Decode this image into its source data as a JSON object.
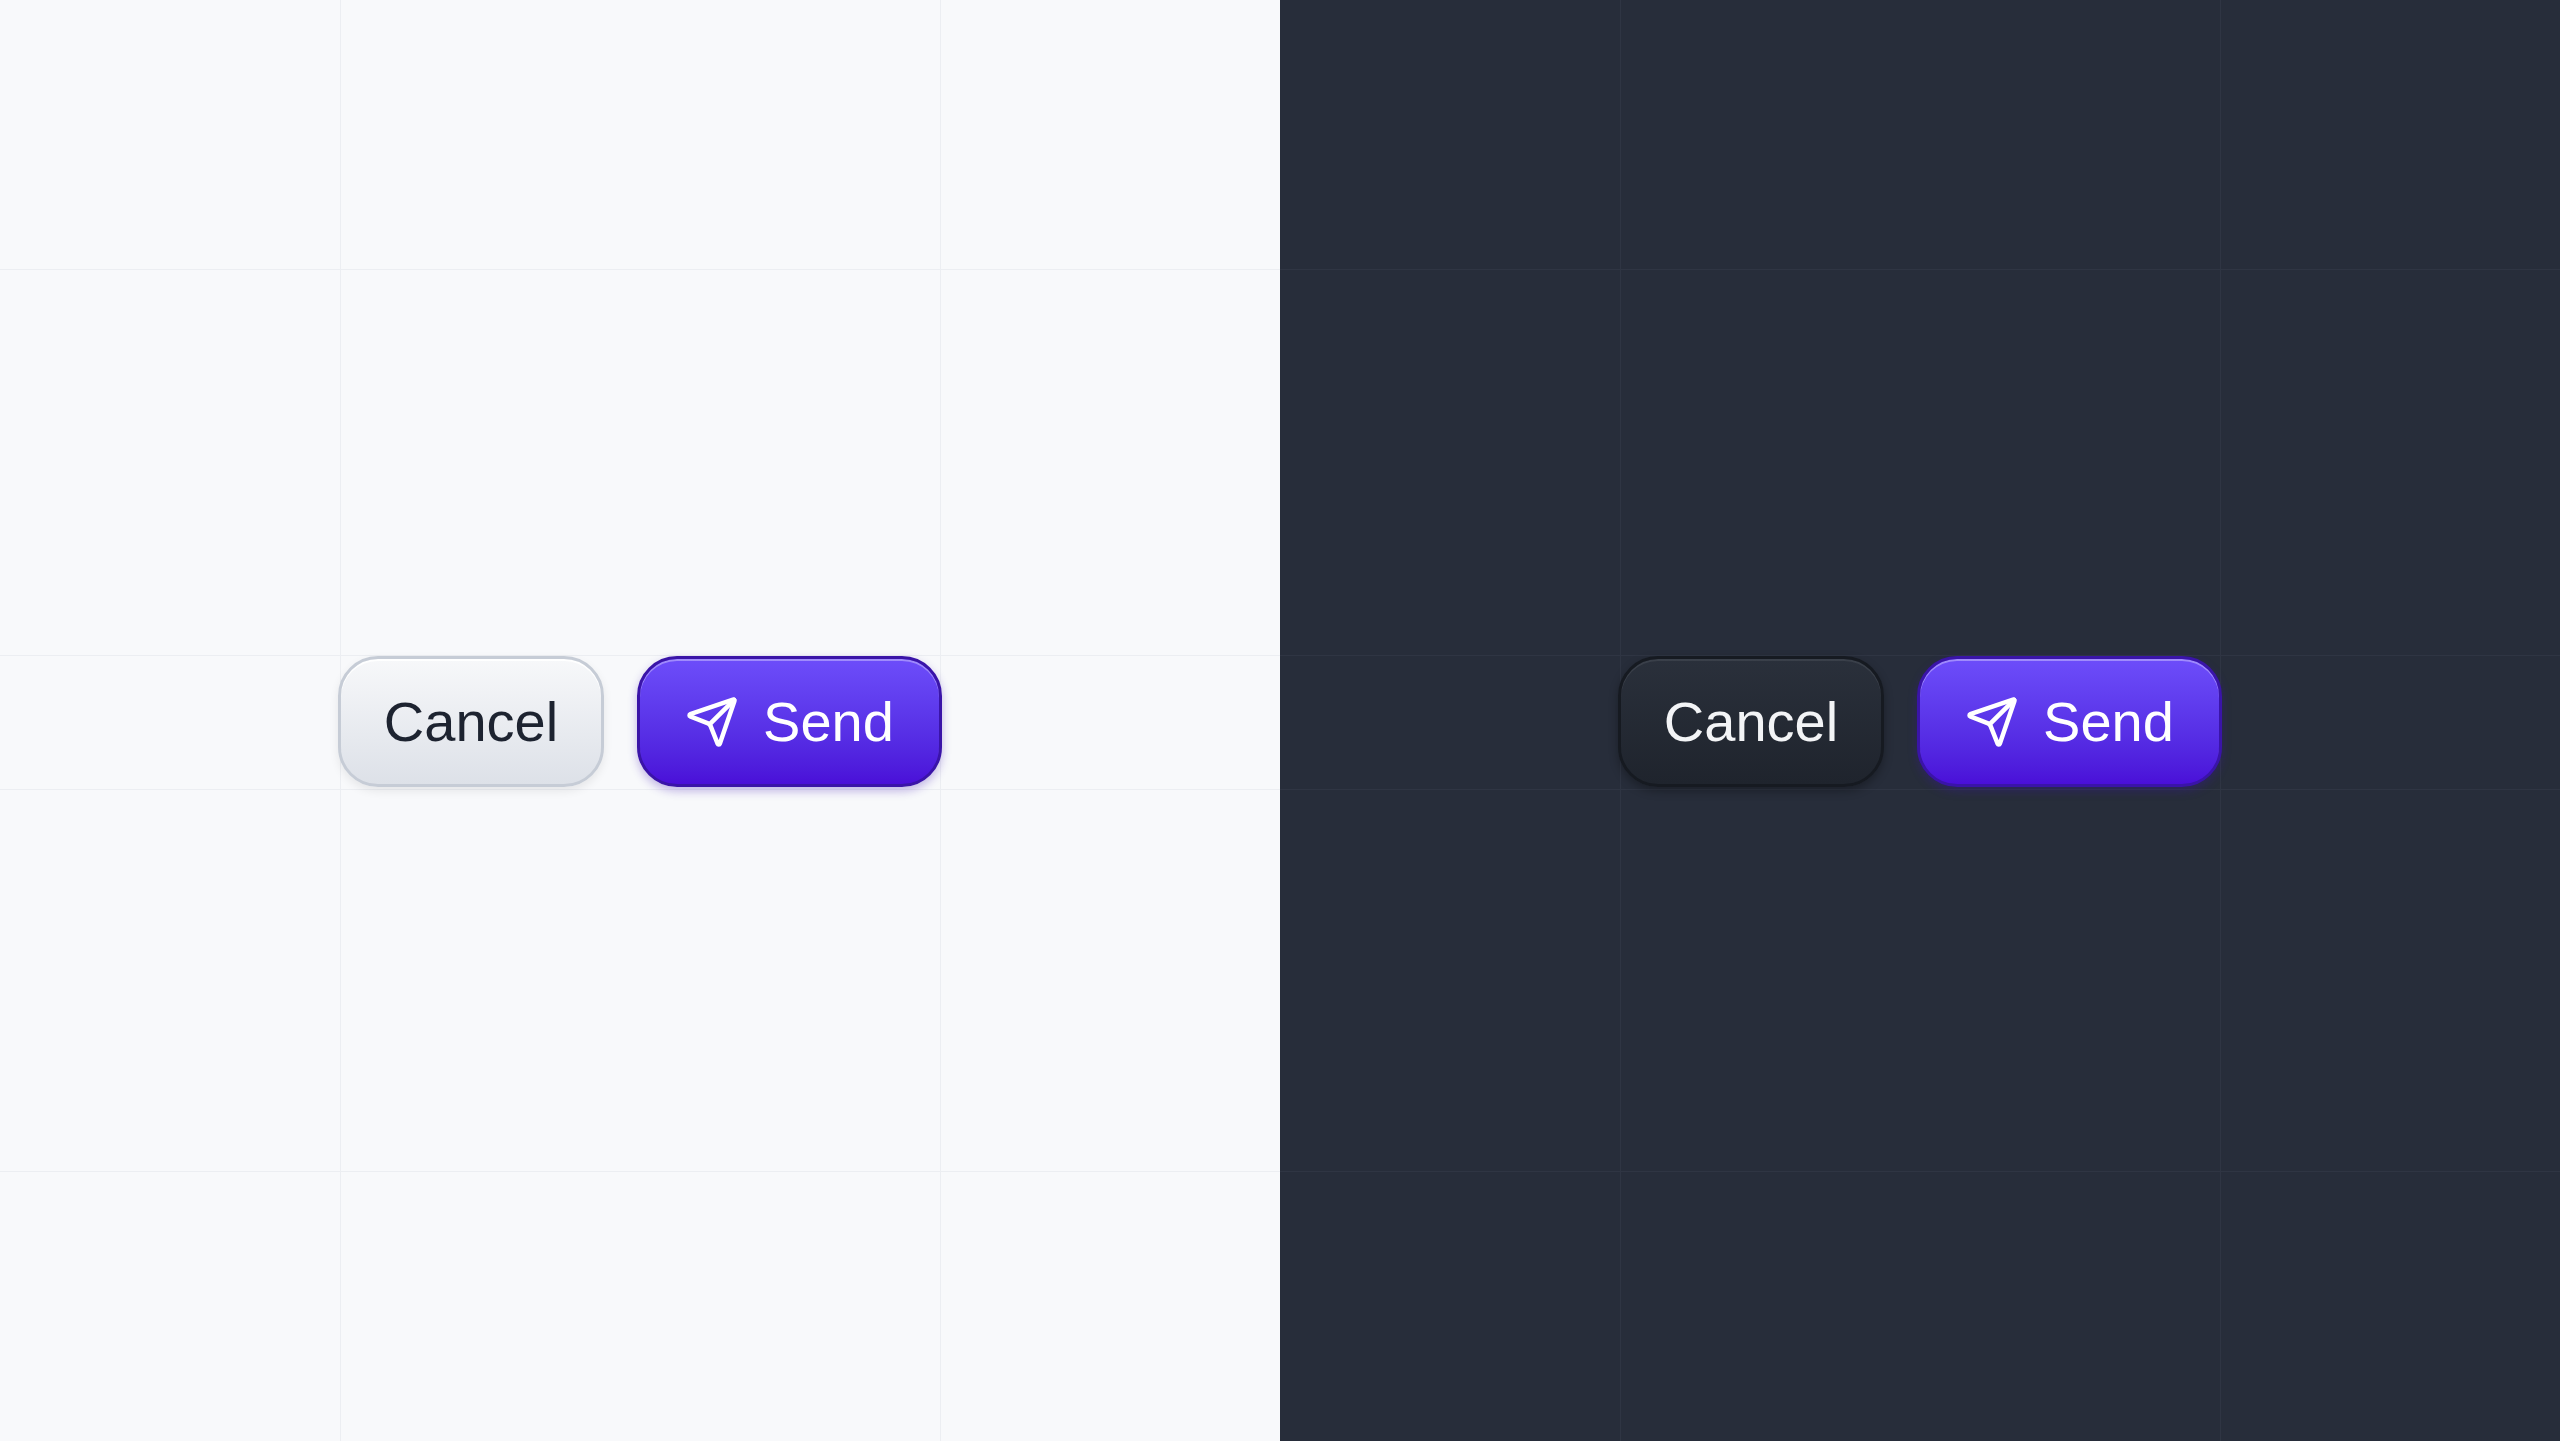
{
  "panels": [
    {
      "dark": false,
      "buttons": [
        {
          "kind": "secondary",
          "label": "Cancel"
        },
        {
          "kind": "primary",
          "label": "Send"
        }
      ]
    },
    {
      "dark": true,
      "buttons": [
        {
          "kind": "secondary",
          "label": "Cancel"
        },
        {
          "kind": "primary",
          "label": "Send"
        }
      ]
    }
  ]
}
